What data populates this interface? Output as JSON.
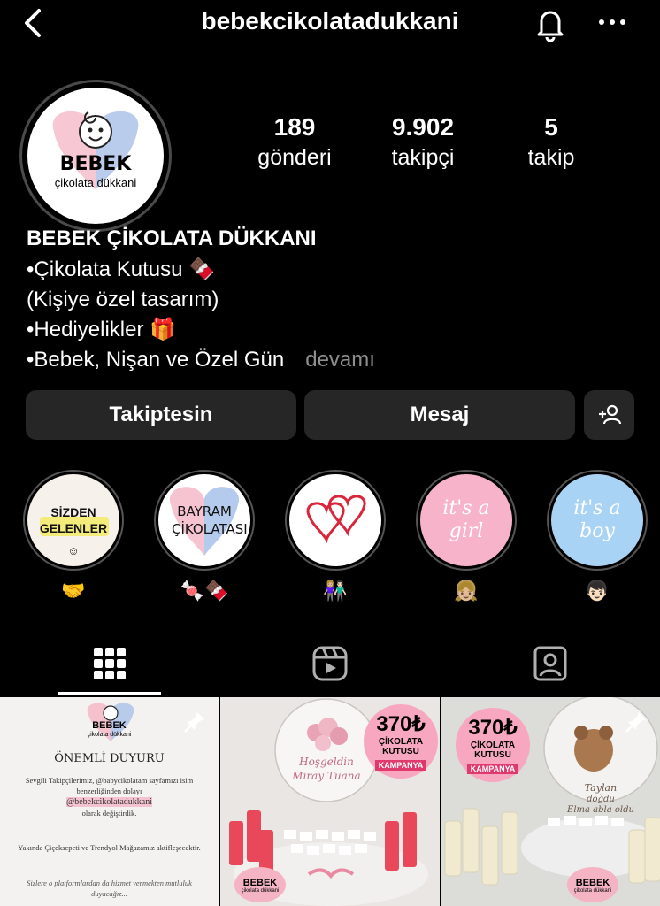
{
  "header": {
    "username": "bebekcikolatadukkani"
  },
  "profile": {
    "logo_title": "BEBEK",
    "logo_subtitle": "çikolata dükkani",
    "stats": [
      {
        "value": "189",
        "label": "gönderi"
      },
      {
        "value": "9.902",
        "label": "takipçi"
      },
      {
        "value": "5",
        "label": "takip"
      }
    ],
    "display_name": "BEBEK ÇİKOLATA DÜKKANI",
    "bio_lines": [
      "•Çikolata Kutusu 🍫",
      "(Kişiye özel tasarım)",
      "•Hediyelikler 🎁",
      "•Bebek, Nişan ve Özel Gün"
    ],
    "more_label": "devamı"
  },
  "actions": {
    "follow_label": "Takiptesin",
    "message_label": "Mesaj"
  },
  "highlights": [
    {
      "cover_text": "SİZDEN GELENLER",
      "emoji": "☺",
      "label": "🤝"
    },
    {
      "cover_text": "BAYRAM ÇİKOLATASI",
      "label": "🍬🍫"
    },
    {
      "label": "👩🏼‍🤝‍👨🏻"
    },
    {
      "cover_text": "it's a girl",
      "label": "👧🏼"
    },
    {
      "cover_text": "it's a boy",
      "label": "👦🏻"
    }
  ],
  "posts": {
    "post1": {
      "logo_title": "BEBEK",
      "logo_subtitle": "çikolata dükkani",
      "heading": "ÖNEMLİ DUYURU",
      "paragraph1": "Sevgili Takipçilerimiz, @babycikolatam sayfamızı isim benzerliğinden dolayı",
      "handle": "@bebekcikolatadukkani",
      "paragraph1_end": "olarak değiştirdik.",
      "paragraph2": "Yakında Çiçeksepeti ve Trendyol Mağazamız aktifleşecektir.",
      "paragraph3": "Sizlere o platformlardan da hizmet vermekten mutluluk duyacağız..."
    },
    "post2": {
      "price": "370₺",
      "badge_line1": "ÇİKOLATA",
      "badge_line2": "KUTUSU",
      "badge_tag": "KAMPANYA",
      "lid_line1": "Hoşgeldin",
      "lid_line2": "Miray Tuana",
      "logo_title": "BEBEK",
      "logo_subtitle": "çikolata dükkani"
    },
    "post3": {
      "price": "370₺",
      "badge_line1": "ÇİKOLATA",
      "badge_line2": "KUTUSU",
      "badge_tag": "KAMPANYA",
      "lid_line1": "Taylan",
      "lid_line2": "doğdu",
      "lid_line3": "Elma abla oldu",
      "logo_title": "BEBEK",
      "logo_subtitle": "çikolata dükkani"
    }
  },
  "colors": {
    "background": "#000000",
    "button": "#262626",
    "muted": "#8e8e8e",
    "pink": "#f7a8c0",
    "blue": "#a9cdf2"
  }
}
